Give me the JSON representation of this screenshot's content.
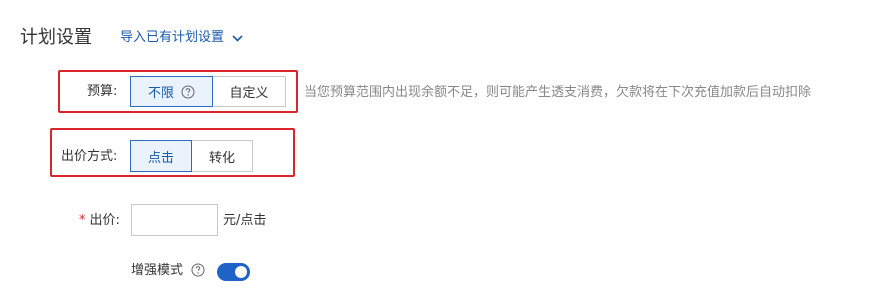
{
  "header": {
    "title": "计划设置",
    "import_link": "导入已有计划设置",
    "import_icon": "chevron-down-icon"
  },
  "budget": {
    "label": "预算:",
    "options": [
      {
        "label": "不限",
        "selected": true,
        "icon": "help-circle-icon"
      },
      {
        "label": "自定义",
        "selected": false
      }
    ],
    "hint": "当您预算范围内出现余额不足，则可能产生透支消费，欠款将在下次充值加款后自动扣除"
  },
  "bidding_method": {
    "label": "出价方式:",
    "options": [
      {
        "label": "点击",
        "selected": true
      },
      {
        "label": "转化",
        "selected": false
      }
    ]
  },
  "bid": {
    "required_mark": "*",
    "label": "出价:",
    "value": "",
    "placeholder": "",
    "unit": "元/点击"
  },
  "enhanced_mode": {
    "label": "增强模式",
    "help_icon": "help-circle-icon",
    "enabled": true
  },
  "colors": {
    "accent": "#1f63c6",
    "link": "#1a5aa8",
    "highlight_border": "#d9262c",
    "selected_bg": "#eaf2fc",
    "hint": "#888888"
  }
}
